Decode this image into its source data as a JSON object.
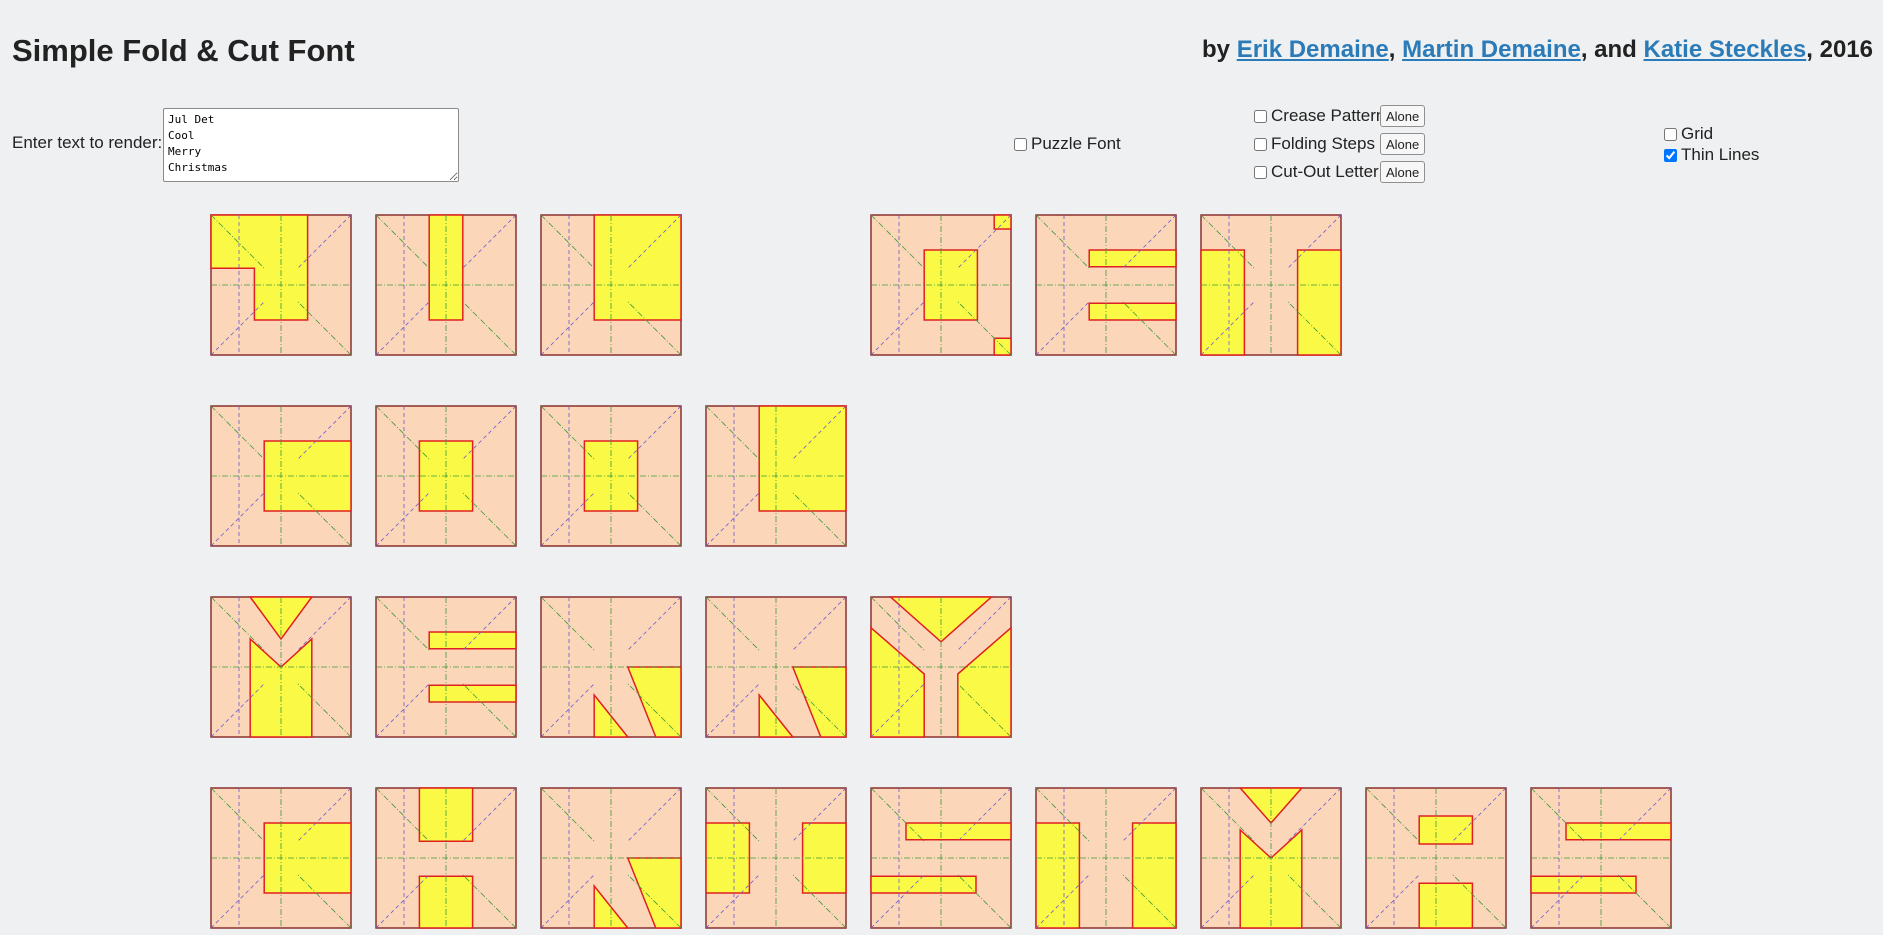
{
  "header": {
    "title": "Simple Fold & Cut Font",
    "by_prefix": "by ",
    "authors": [
      "Erik Demaine",
      "Martin Demaine",
      "Katie Steckles"
    ],
    "sep1": ", ",
    "sep2": ", and ",
    "year": ", 2016"
  },
  "controls": {
    "input_label": "Enter text to render:",
    "input_value": "Jul Det\nCool\nMerry\nChristmas",
    "puzzle_font": {
      "label": "Puzzle Font",
      "checked": false
    },
    "crease_pattern": {
      "label": "Crease Pattern",
      "checked": false,
      "button": "Alone"
    },
    "folding_steps": {
      "label": "Folding Steps",
      "checked": false,
      "button": "Alone"
    },
    "cut_out_letter": {
      "label": "Cut-Out Letter",
      "checked": false,
      "button": "Alone"
    },
    "grid": {
      "label": "Grid",
      "checked": false
    },
    "thin_lines": {
      "label": "Thin Lines",
      "checked": true
    }
  },
  "colors": {
    "paper": "#fcd6b8",
    "letter": "#fafa46",
    "cut": "#e02020",
    "valley": "#3a9a3a",
    "mountain": "#6a5ad0",
    "border": "#8a3030"
  },
  "rendered_lines": [
    [
      "J",
      "u",
      "l",
      " ",
      "D",
      "e",
      "t"
    ],
    [
      "C",
      "o",
      "o",
      "l"
    ],
    [
      "M",
      "e",
      "r",
      "r",
      "y"
    ],
    [
      "C",
      "h",
      "r",
      "i",
      "s",
      "t",
      "m",
      "a",
      "s"
    ]
  ]
}
